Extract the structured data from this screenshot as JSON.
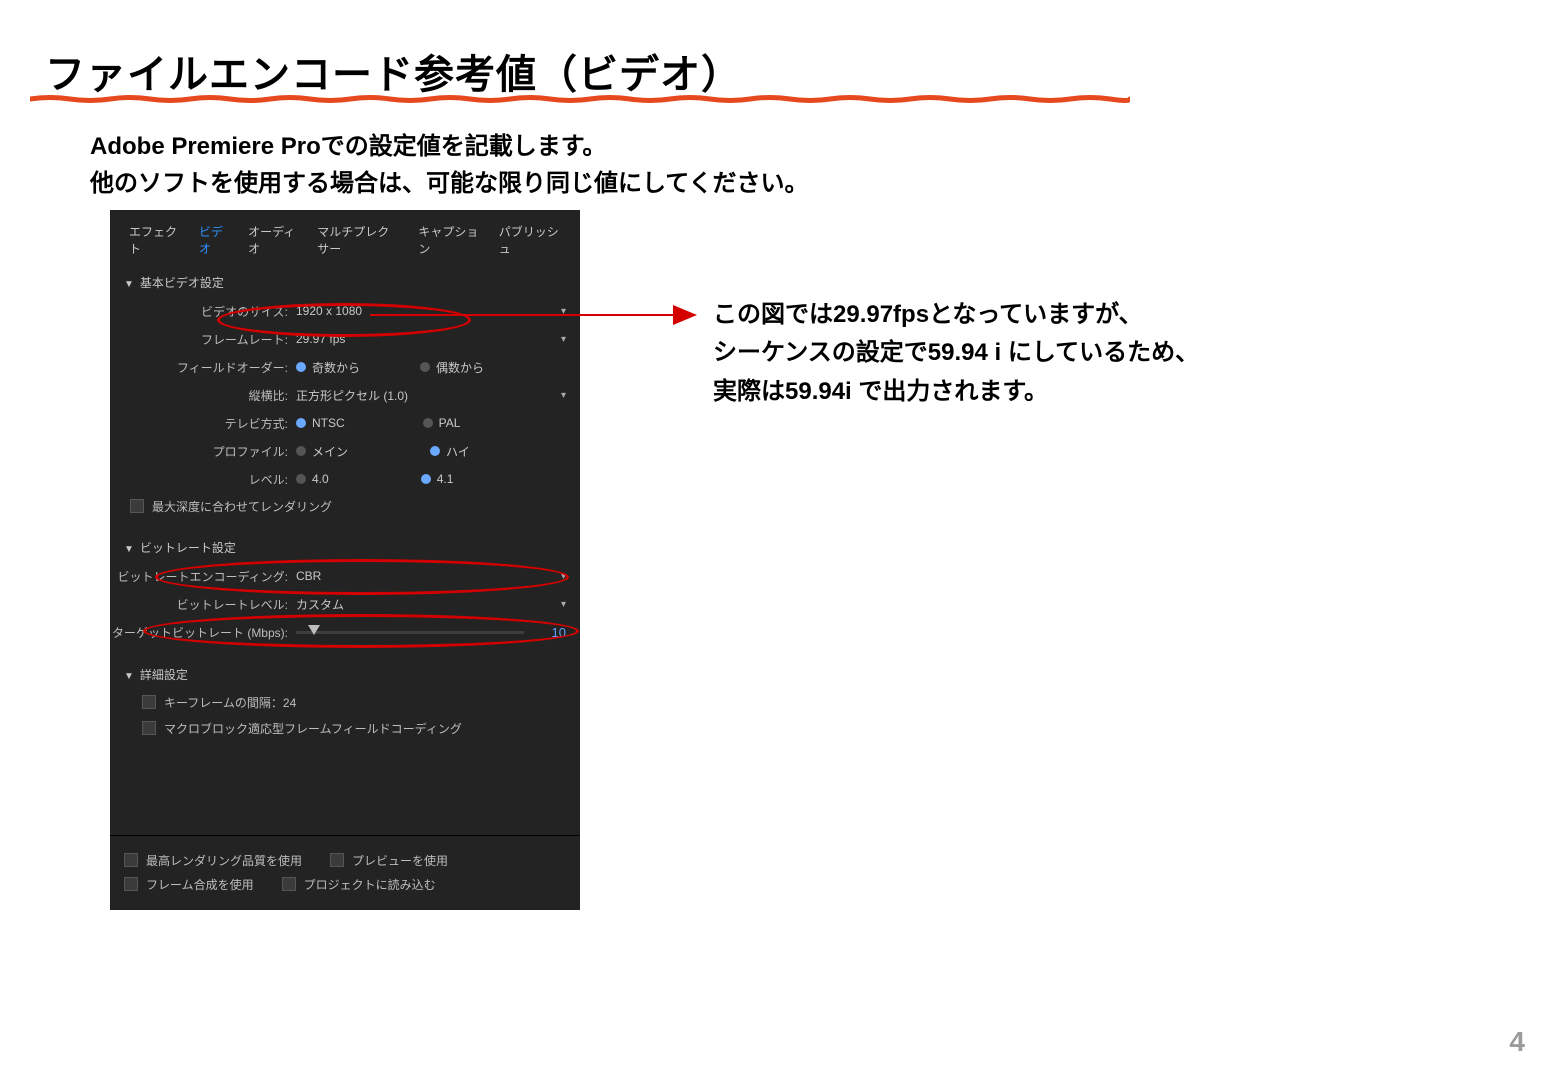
{
  "slide": {
    "title": "ファイルエンコード参考値（ビデオ）",
    "desc_line1": "Adobe Premiere Proでの設定値を記載します。",
    "desc_line2": "他のソフトを使用する場合は、可能な限り同じ値にしてください。",
    "page_number": "4"
  },
  "panel": {
    "tabs": {
      "effect": "エフェクト",
      "video": "ビデオ",
      "audio": "オーディオ",
      "multiplexer": "マルチプレクサー",
      "caption": "キャプション",
      "publish": "パブリッシュ"
    },
    "sections": {
      "basic": {
        "title": "基本ビデオ設定",
        "video_size_label": "ビデオのサイズ:",
        "video_size_value": "1920 x 1080",
        "framerate_label": "フレームレート:",
        "framerate_value": "29.97 fps",
        "field_order_label": "フィールドオーダー:",
        "field_order_opt1": "奇数から",
        "field_order_opt2": "偶数から",
        "aspect_label": "縦横比:",
        "aspect_value": "正方形ピクセル (1.0)",
        "tv_label": "テレビ方式:",
        "tv_opt1": "NTSC",
        "tv_opt2": "PAL",
        "profile_label": "プロファイル:",
        "profile_opt1": "メイン",
        "profile_opt2": "ハイ",
        "level_label": "レベル:",
        "level_opt1": "4.0",
        "level_opt2": "4.1",
        "max_depth": "最大深度に合わせてレンダリング"
      },
      "bitrate": {
        "title": "ビットレート設定",
        "encoding_label": "ビットレートエンコーディング:",
        "encoding_value": "CBR",
        "level_label": "ビットレートレベル:",
        "level_value": "カスタム",
        "target_label": "ターゲットビットレート (Mbps):",
        "target_value": "10"
      },
      "advanced": {
        "title": "詳細設定",
        "keyframe": "キーフレームの間隔：24",
        "macroblock": "マクロブロック適応型フレームフィールドコーディング"
      }
    },
    "bottom": {
      "max_quality": "最高レンダリング品質を使用",
      "preview": "プレビューを使用",
      "frame_blend": "フレーム合成を使用",
      "project_import": "プロジェクトに読み込む"
    }
  },
  "annotation": {
    "line1": "この図では29.97fpsとなっていますが、",
    "line2": "シーケンスの設定で59.94 i にしているため、",
    "line3": "実際は59.94i で出力されます。"
  }
}
